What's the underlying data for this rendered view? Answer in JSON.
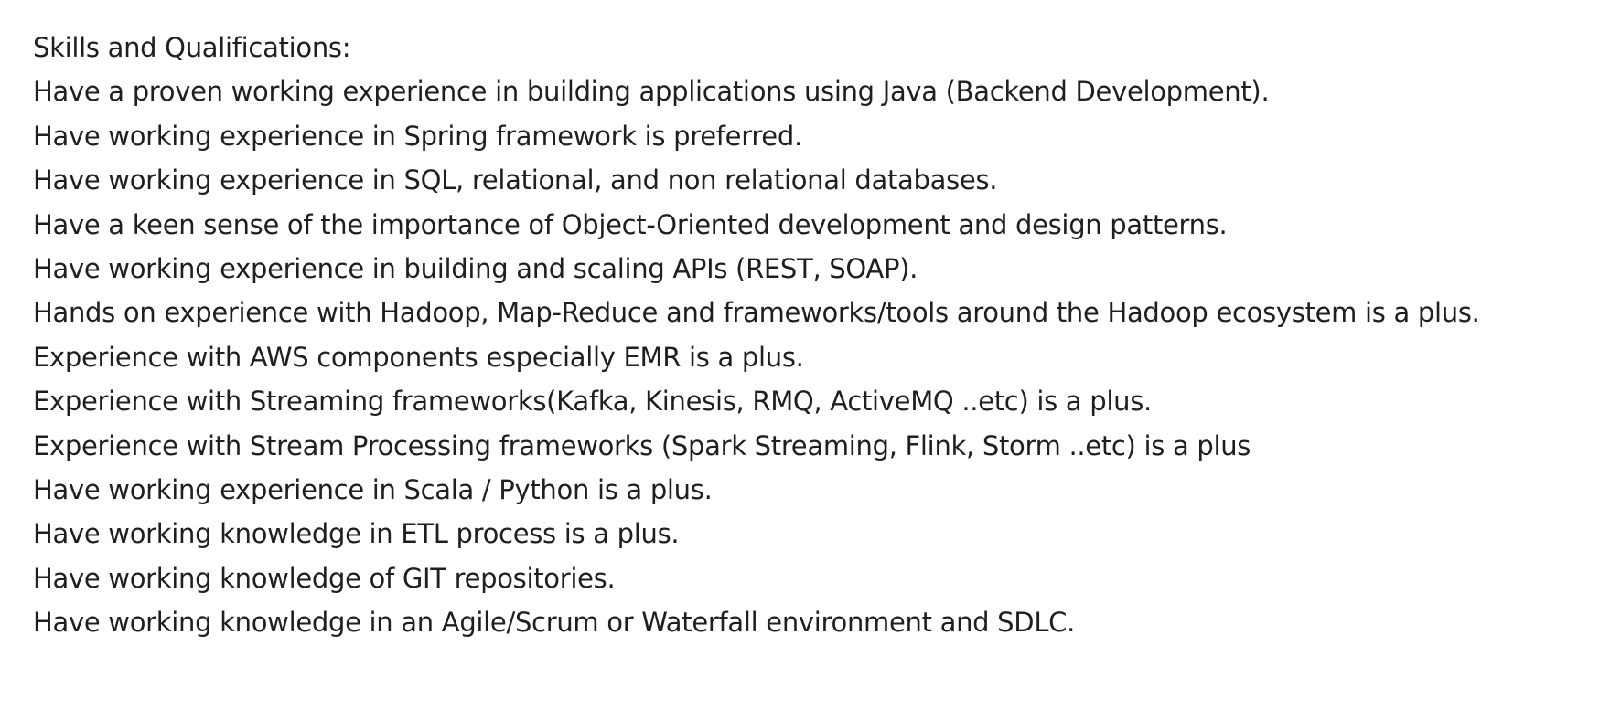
{
  "section": {
    "heading": "Skills and Qualifications:",
    "items": [
      "Have a proven working experience in building applications using Java (Backend Development).",
      "Have working experience in Spring framework is preferred.",
      "Have working experience in SQL, relational, and non relational databases.",
      "Have a keen sense of the importance of Object-Oriented development and design patterns.",
      "Have working experience in building and scaling APIs (REST, SOAP).",
      "Hands on experience with Hadoop, Map-Reduce and frameworks/tools around the Hadoop ecosystem is a plus.",
      "Experience with AWS components especially EMR is a plus.",
      "Experience with Streaming frameworks(Kafka, Kinesis, RMQ, ActiveMQ ..etc) is a plus.",
      "Experience with Stream Processing frameworks (Spark Streaming, Flink, Storm ..etc) is a plus",
      "Have working experience in Scala / Python is a plus.",
      "Have working knowledge in ETL process is a plus.",
      "Have working knowledge of GIT repositories.",
      "Have working knowledge in an Agile/Scrum or Waterfall environment and SDLC."
    ]
  }
}
